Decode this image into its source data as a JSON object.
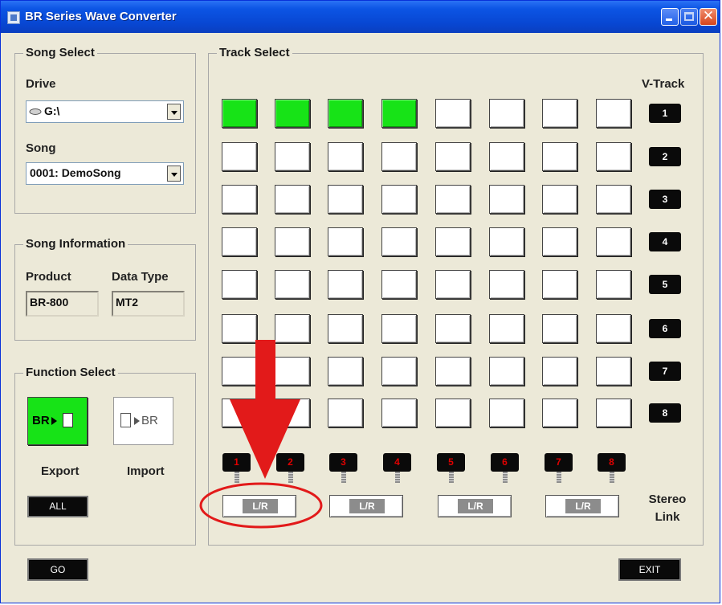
{
  "window": {
    "title": "BR Series Wave Converter"
  },
  "song_select": {
    "title": "Song Select",
    "drive_label": "Drive",
    "drive_value": "G:\\",
    "song_label": "Song",
    "song_value": "0001: DemoSong"
  },
  "song_info": {
    "title": "Song Information",
    "product_label": "Product",
    "product_value": "BR-800",
    "datatype_label": "Data Type",
    "datatype_value": "MT2"
  },
  "function_select": {
    "title": "Function Select",
    "export_icon_text": "BR",
    "import_icon_text": "BR",
    "export_label": "Export",
    "import_label": "Import",
    "all_button": "ALL"
  },
  "track_select": {
    "title": "Track Select",
    "vtrack_label": "V-Track",
    "vtracks": [
      "1",
      "2",
      "3",
      "4",
      "5",
      "6",
      "7",
      "8"
    ],
    "channels": [
      "1",
      "2",
      "3",
      "4",
      "5",
      "6",
      "7",
      "8"
    ],
    "selected": [
      [
        true,
        true,
        true,
        true,
        false,
        false,
        false,
        false
      ],
      [
        false,
        false,
        false,
        false,
        false,
        false,
        false,
        false
      ],
      [
        false,
        false,
        false,
        false,
        false,
        false,
        false,
        false
      ],
      [
        false,
        false,
        false,
        false,
        false,
        false,
        false,
        false
      ],
      [
        false,
        false,
        false,
        false,
        false,
        false,
        false,
        false
      ],
      [
        false,
        false,
        false,
        false,
        false,
        false,
        false,
        false
      ],
      [
        false,
        false,
        false,
        false,
        false,
        false,
        false,
        false
      ],
      [
        false,
        false,
        false,
        false,
        false,
        false,
        false,
        false
      ]
    ],
    "lr_label": "L/R",
    "stereo_link_line1": "Stereo",
    "stereo_link_line2": "Link"
  },
  "buttons": {
    "go": "GO",
    "exit": "EXIT"
  },
  "colors": {
    "selected_track": "#17e317",
    "annotation": "#e21a1a"
  },
  "annotation": {
    "shapes": [
      "arrow-down",
      "ellipse"
    ]
  }
}
